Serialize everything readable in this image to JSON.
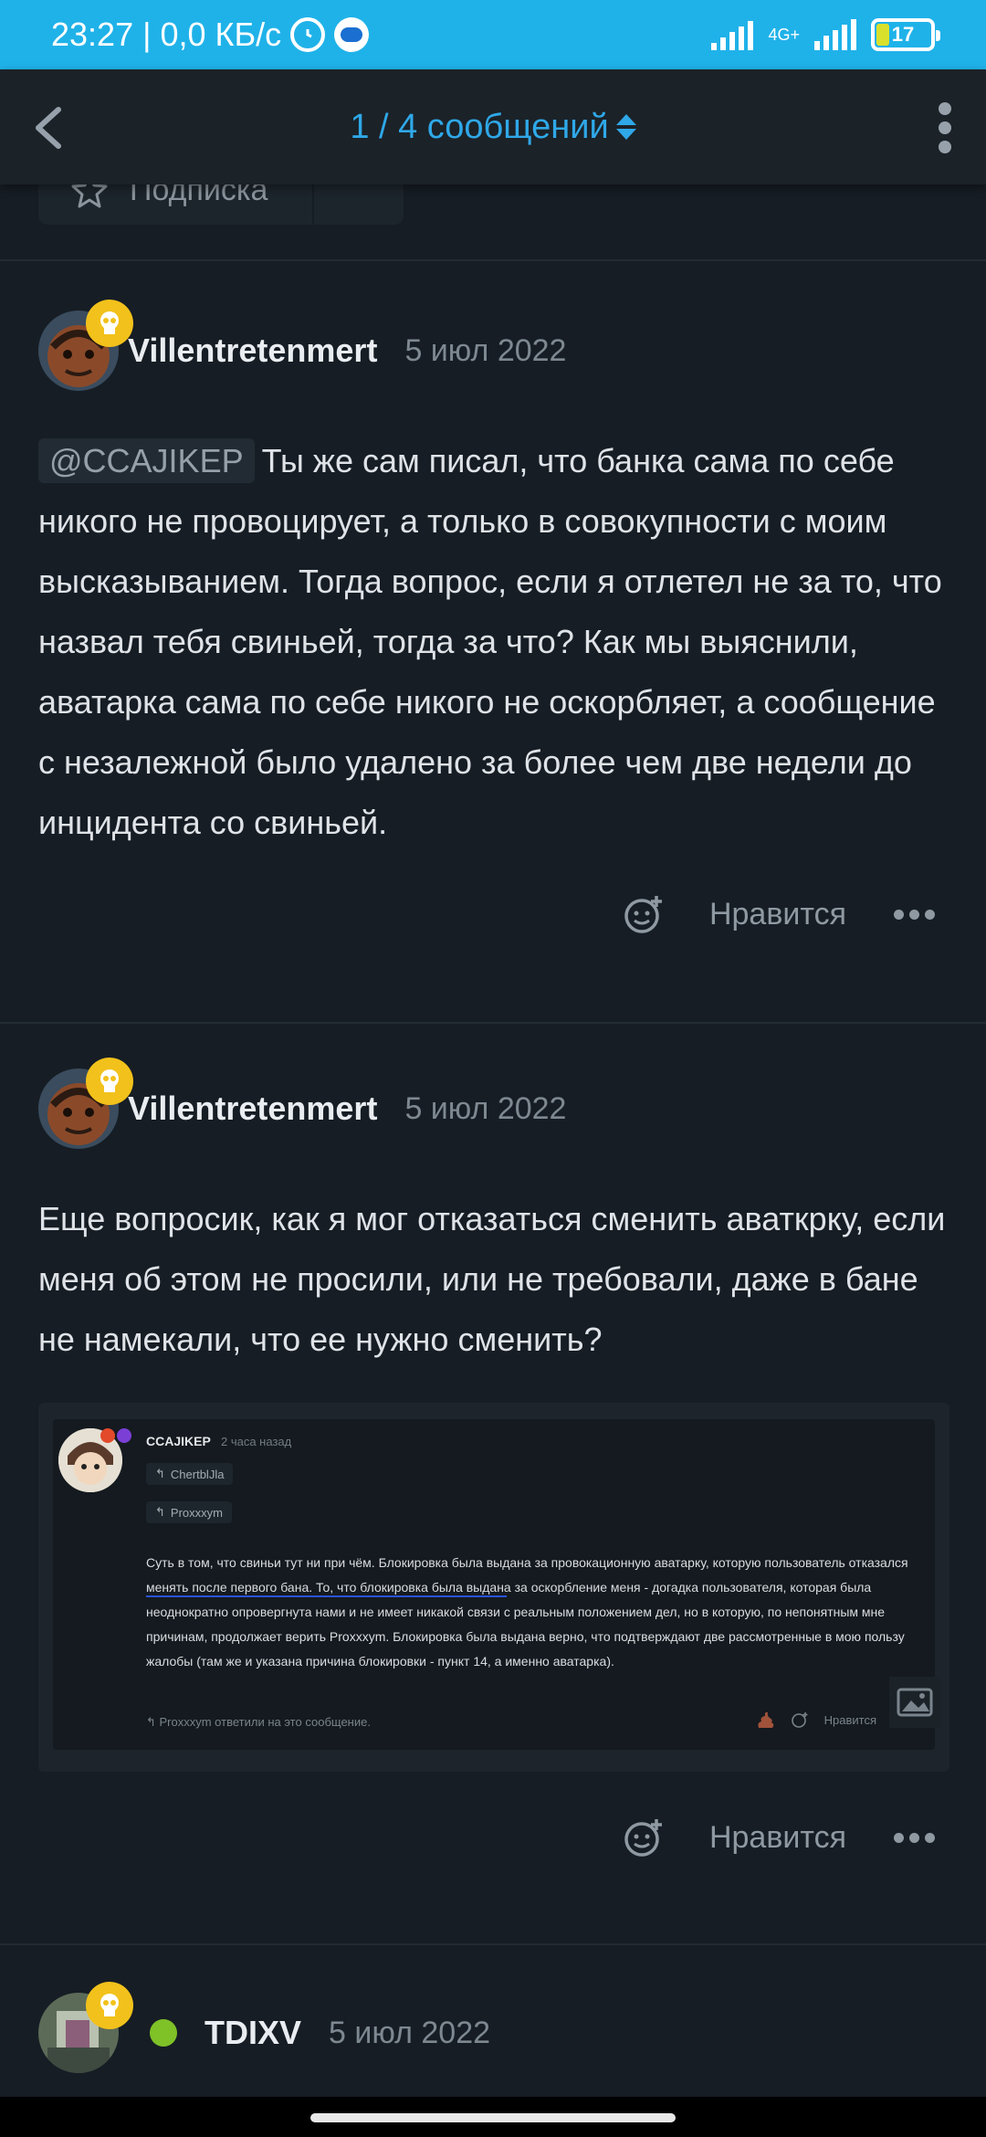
{
  "status_bar": {
    "time_speed": "23:27 | 0,0 КБ/с",
    "network": "4G+",
    "battery": "17"
  },
  "top_bar": {
    "pager": "1 / 4 сообщений"
  },
  "subscribe_label": "Подписка",
  "posts": [
    {
      "author": "Villentretenmert",
      "date": "5 июл 2022",
      "mention": "@CCAJIKEP",
      "text": "Ты же сам писал, что банка сама по себе никого не провоцирует, а только в совокупности с моим высказыванием. Тогда вопрос, если я отлетел не за то, что назвал тебя свиньей, тогда за что? Как мы выяснили, аватарка сама по себе никого не оскорбляет, а сообщение с незалежной было удалено за более чем две недели до инцидента со свиньей.",
      "like_label": "Нравится"
    },
    {
      "author": "Villentretenmert",
      "date": "5 июл 2022",
      "text": "Еще вопросик, как я мог отказаться сменить аваткрку, если меня об этом не просили, или не требовали, даже в бане не намекали, что ее нужно сменить?",
      "like_label": "Нравится",
      "embed": {
        "author": "CCAJIKEP",
        "time": "2 часа назад",
        "quote_1": "Chertbl‌Jla",
        "quote_2": "Proxxxym",
        "text": "Суть в том, что свиньи тут ни при чём. Блокировка была выдана за провокационную аватарку, которую пользователь отказался менять после первого бана. То, что блокировка была выдана за оскорбление меня - догадка пользователя, которая была неоднократно опровергнута нами и не имеет никакой связи с реальным положением дел, но в которую, по непонятным мне причинам, продолжает верить Proxxxym. Блокировка была выдана верно, что подтверждают две рассмотренные в мою пользу жалобы (там же и указана причина блокировки - пункт 14, а именно аватарка).",
        "replied": "Proxxxym ответили на это сообщение.",
        "like_label": "Нравится"
      }
    },
    {
      "author": "TDIXV",
      "date": "5 июл 2022"
    }
  ],
  "colors": {
    "accent": "#2fa8e8",
    "status_bar": "#1fb2e9",
    "background": "#161d24",
    "badge": "#f2c11b",
    "online": "#7ec227"
  }
}
